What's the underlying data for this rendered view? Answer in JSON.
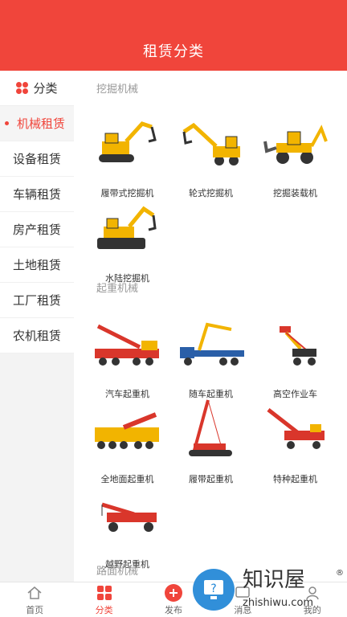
{
  "header": {
    "title": "租赁分类"
  },
  "sidebar": {
    "heading": "分类",
    "items": [
      {
        "label": "机械租赁"
      },
      {
        "label": "设备租赁"
      },
      {
        "label": "车辆租赁"
      },
      {
        "label": "房产租赁"
      },
      {
        "label": "土地租赁"
      },
      {
        "label": "工厂租赁"
      },
      {
        "label": "农机租赁"
      }
    ]
  },
  "sections": [
    {
      "title": "挖掘机械",
      "items": [
        {
          "label": "履带式挖掘机"
        },
        {
          "label": "轮式挖掘机"
        },
        {
          "label": "挖掘装载机"
        },
        {
          "label": "水陆挖掘机"
        }
      ]
    },
    {
      "title": "起重机械",
      "items": [
        {
          "label": "汽车起重机"
        },
        {
          "label": "随车起重机"
        },
        {
          "label": "高空作业车"
        },
        {
          "label": "全地面起重机"
        },
        {
          "label": "履带起重机"
        },
        {
          "label": "特种起重机"
        },
        {
          "label": "越野起重机"
        }
      ]
    },
    {
      "title": "路面机械",
      "items": []
    }
  ],
  "tabbar": {
    "tabs": [
      {
        "label": "首页",
        "icon": "home-icon"
      },
      {
        "label": "分类",
        "icon": "category-icon"
      },
      {
        "label": "发布",
        "icon": "plus-icon"
      },
      {
        "label": "消息",
        "icon": "message-icon"
      },
      {
        "label": "我的",
        "icon": "user-icon"
      }
    ]
  },
  "watermark": {
    "text": "知识屋",
    "sub": "zhishiwu.com",
    "mark": "®"
  },
  "colors": {
    "brand": "#f0453b",
    "machine_yellow": "#f2b400",
    "machine_red": "#d9362b"
  }
}
